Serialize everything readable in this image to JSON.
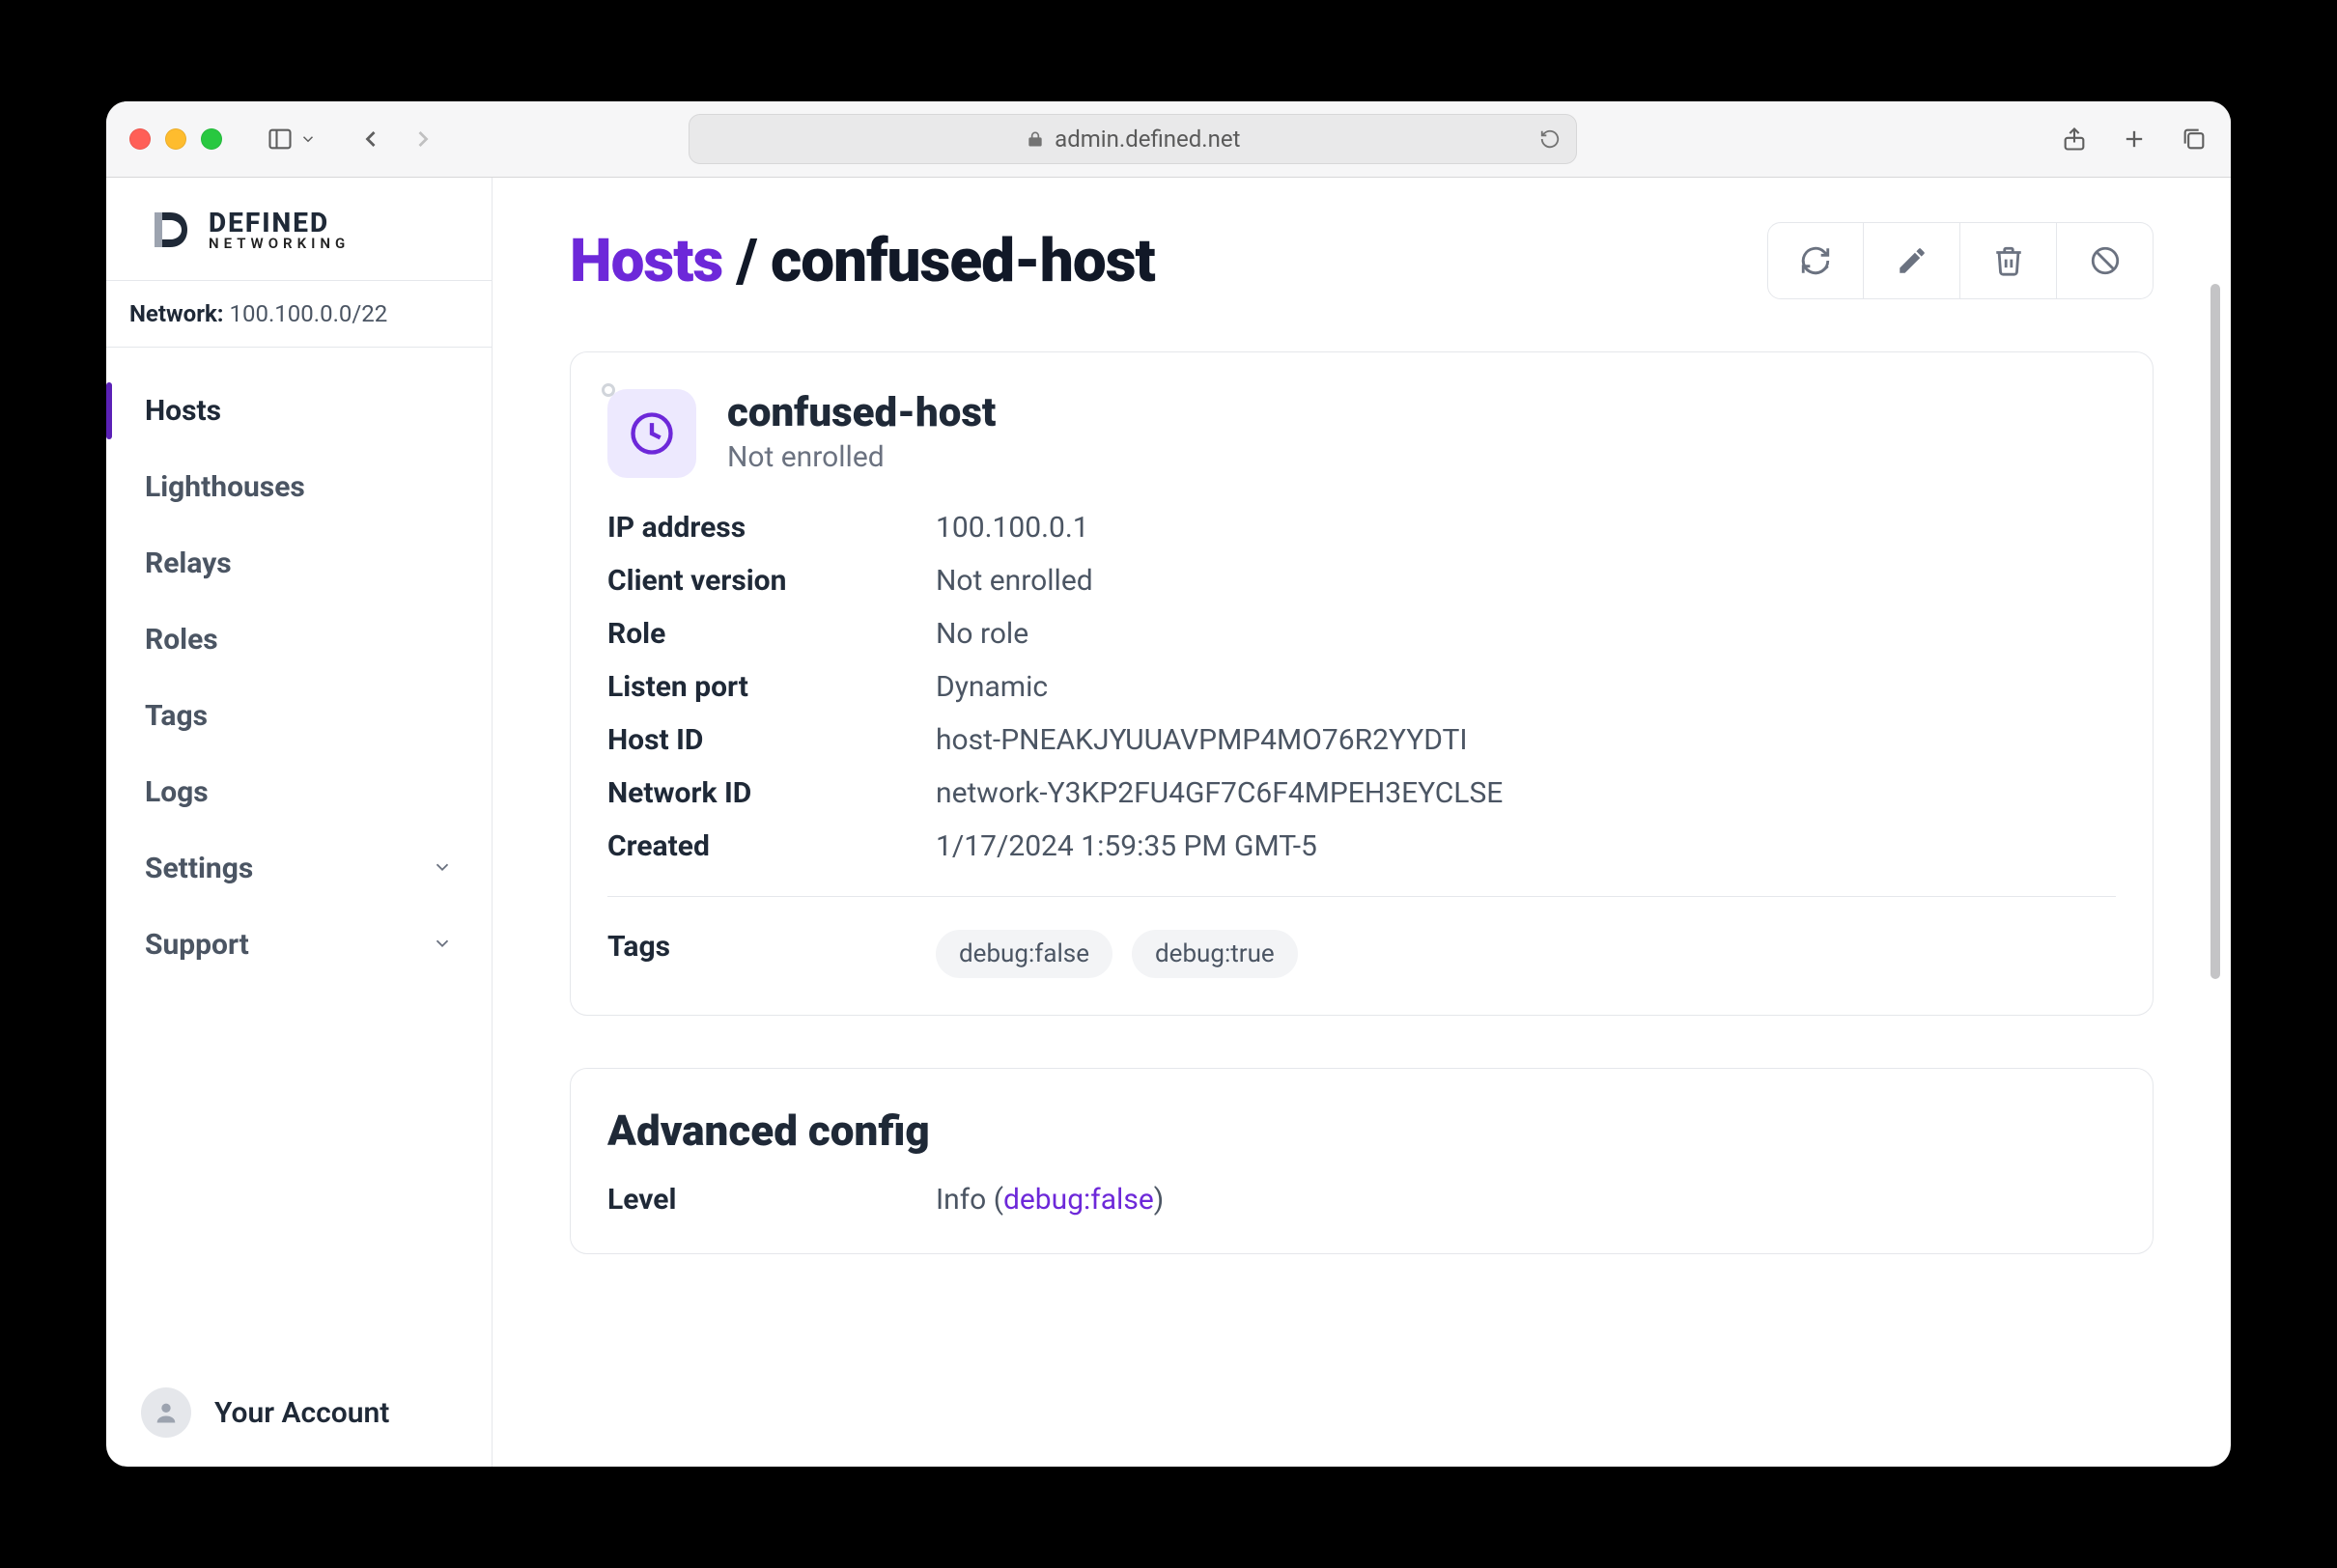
{
  "browser": {
    "url": "admin.defined.net"
  },
  "brand": {
    "name": "DEFINED",
    "tagline": "NETWORKING"
  },
  "network_label": "Network:",
  "network_cidr": "100.100.0.0/22",
  "sidebar": {
    "items": [
      {
        "label": "Hosts",
        "active": true,
        "expandable": false
      },
      {
        "label": "Lighthouses",
        "active": false,
        "expandable": false
      },
      {
        "label": "Relays",
        "active": false,
        "expandable": false
      },
      {
        "label": "Roles",
        "active": false,
        "expandable": false
      },
      {
        "label": "Tags",
        "active": false,
        "expandable": false
      },
      {
        "label": "Logs",
        "active": false,
        "expandable": false
      },
      {
        "label": "Settings",
        "active": false,
        "expandable": true
      },
      {
        "label": "Support",
        "active": false,
        "expandable": true
      }
    ]
  },
  "account_label": "Your Account",
  "crumb": {
    "root": "Hosts",
    "sep": "/",
    "leaf": "confused-host"
  },
  "host": {
    "name": "confused-host",
    "status": "Not enrolled",
    "fields": [
      {
        "k": "IP address",
        "v": "100.100.0.1"
      },
      {
        "k": "Client version",
        "v": "Not enrolled"
      },
      {
        "k": "Role",
        "v": "No role"
      },
      {
        "k": "Listen port",
        "v": "Dynamic"
      },
      {
        "k": "Host ID",
        "v": "host-PNEAKJYUUAVPMP4MO76R2YYDTI"
      },
      {
        "k": "Network ID",
        "v": "network-Y3KP2FU4GF7C6F4MPEH3EYCLSE"
      },
      {
        "k": "Created",
        "v": "1/17/2024 1:59:35 PM GMT-5"
      }
    ],
    "tags_label": "Tags",
    "tags": [
      "debug:false",
      "debug:true"
    ]
  },
  "advanced": {
    "heading": "Advanced config",
    "level_label": "Level",
    "level_value_prefix": "Info (",
    "level_value_link": "debug:false",
    "level_value_suffix": ")"
  }
}
